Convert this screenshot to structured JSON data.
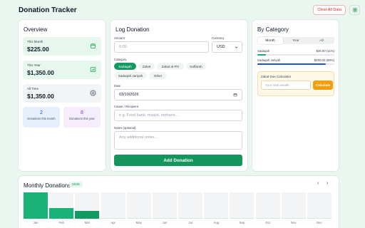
{
  "header": {
    "title": "Donation Tracker",
    "clear_label": "Clear All Data"
  },
  "overview": {
    "title": "Overview",
    "this_month": {
      "label": "This Month",
      "value": "$225.00"
    },
    "this_year": {
      "label": "This Year",
      "value": "$1,350.00"
    },
    "all_time": {
      "label": "All Time",
      "value": "$1,350.00"
    },
    "donations_month": {
      "count": "2",
      "label": "Donations this month"
    },
    "donations_year": {
      "count": "8",
      "label": "Donations this year"
    }
  },
  "log": {
    "title": "Log Donation",
    "amount_label": "Amount",
    "amount_placeholder": "0.00",
    "currency_label": "Currency",
    "currency_value": "USD",
    "category_label": "Category",
    "categories": [
      "Sadaqah",
      "Zakat",
      "Zakat al-Fitr",
      "Kaffarah",
      "Sadaqah Jariyah",
      "Other"
    ],
    "active_category": "Sadaqah",
    "date_label": "Date",
    "date_value": "03/10/2026",
    "cause_label": "Cause / Recipient",
    "cause_placeholder": "e.g. Food bank, masjid, orphans...",
    "notes_label": "Notes (optional)",
    "notes_placeholder": "Any additional notes...",
    "submit_label": "Add Donation"
  },
  "by_category": {
    "title": "By Category",
    "tabs": [
      "Month",
      "Year",
      "All"
    ],
    "active_tab": "Month",
    "rows": [
      {
        "name": "Sadaqah",
        "amount": "$25.00 (11%)",
        "fraction": 0.11,
        "color": "#10b070"
      },
      {
        "name": "Sadaqah Jariyah",
        "amount": "$200.00 (89%)",
        "fraction": 0.89,
        "color": "#1d4fd8"
      }
    ],
    "zakat": {
      "title": "Zakat Due Calculator",
      "placeholder": "Your total wealth",
      "button": "Calculate"
    }
  },
  "monthly": {
    "title": "Monthly Donations",
    "year": "2026",
    "months": [
      "Jan",
      "Feb",
      "Mar",
      "Apr",
      "May",
      "Jun",
      "Jul",
      "Aug",
      "Sep",
      "Oct",
      "Nov",
      "Dec"
    ],
    "fractions": [
      1.0,
      0.4,
      0.3,
      0,
      0,
      0,
      0,
      0,
      0,
      0,
      0,
      0
    ]
  },
  "colors": {
    "accent": "#129a63",
    "danger": "#dc2626",
    "warning": "#f59e0b"
  }
}
